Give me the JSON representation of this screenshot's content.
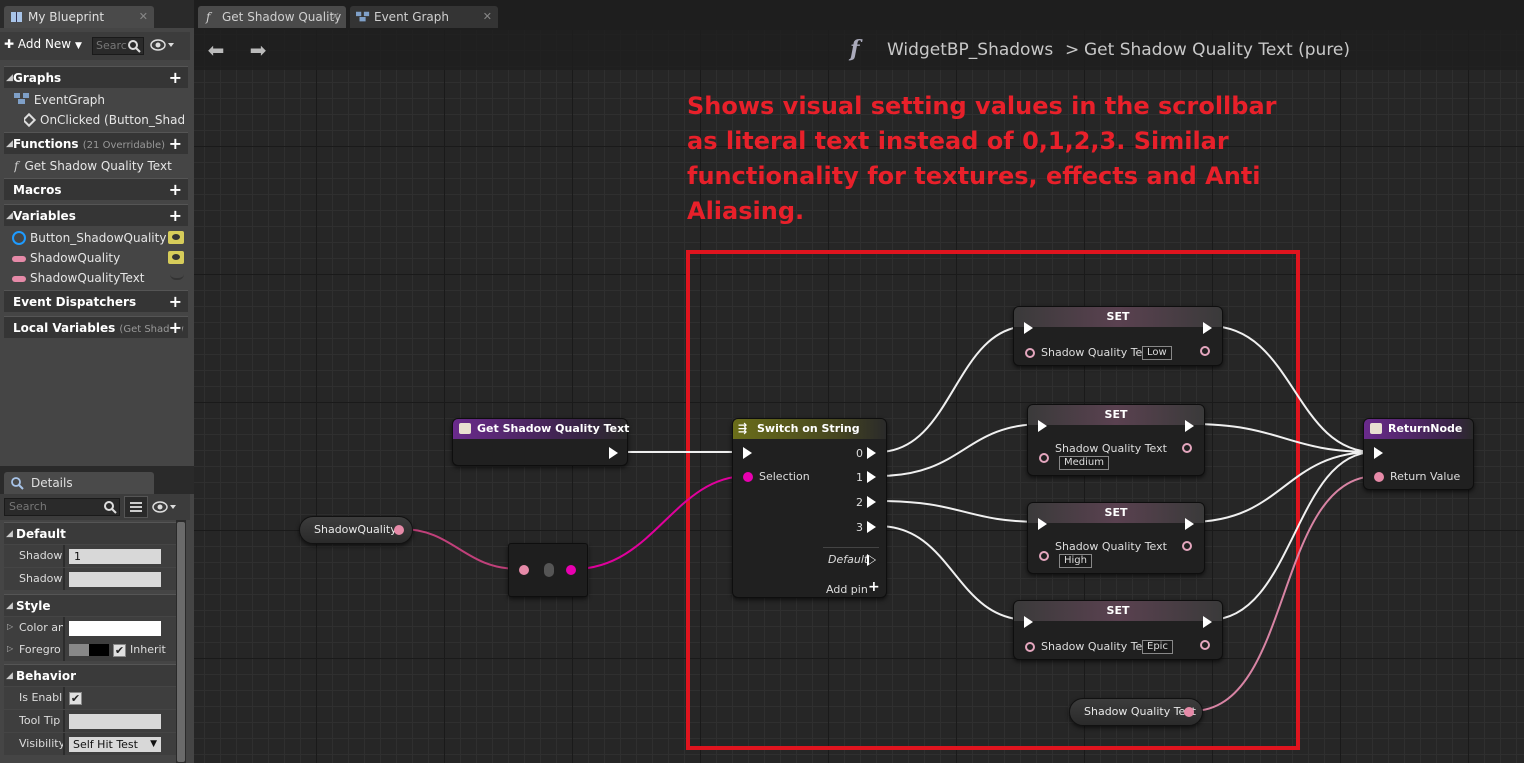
{
  "left_panel": {
    "tab_title": "My Blueprint",
    "add_new_label": "Add New",
    "search_placeholder": "Searc",
    "sections": {
      "graphs": "Graphs",
      "functions": "Functions",
      "functions_sub": "(21 Overridable)",
      "macros": "Macros",
      "variables": "Variables",
      "event_dispatchers": "Event Dispatchers",
      "local_variables": "Local Variables",
      "local_variables_sub": "(Get Shadow"
    },
    "graph_items": [
      "EventGraph",
      "OnClicked (Button_Shad"
    ],
    "function_items": [
      "Get Shadow Quality Text"
    ],
    "variable_items": [
      "Button_ShadowQuality",
      "ShadowQuality",
      "ShadowQualityText"
    ]
  },
  "details": {
    "tab_title": "Details",
    "search_placeholder": "Search",
    "sections": {
      "default": "Default",
      "style": "Style",
      "behavior": "Behavior"
    },
    "default_rows": [
      {
        "label": "Shadow",
        "value": "1"
      },
      {
        "label": "Shadow",
        "value": ""
      }
    ],
    "style_rows": [
      {
        "label": "Color an"
      },
      {
        "label": "Foregro",
        "inherit_label": "Inherit"
      }
    ],
    "behavior_rows": [
      {
        "label": "Is Enabl"
      },
      {
        "label": "Tool Tip",
        "value": ""
      },
      {
        "label": "Visibility",
        "value": "Self Hit Test"
      }
    ]
  },
  "graph_tabs": [
    "Get Shadow Quality",
    "Event Graph"
  ],
  "breadcrumb": {
    "root": "WidgetBP_Shadows",
    "separator": ">",
    "current": "Get Shadow Quality Text (pure)"
  },
  "comment": "Shows visual setting values in the scrollbar as literal text instead of 0,1,2,3. Similar functionality for textures, effects and Anti Aliasing.",
  "nodes": {
    "entry": {
      "title": "Get Shadow Quality Text"
    },
    "get_var": {
      "label": "ShadowQuality"
    },
    "switch": {
      "title": "Switch on String",
      "selection": "Selection",
      "outputs": [
        "0",
        "1",
        "2",
        "3"
      ],
      "default_label": "Default",
      "add_pin": "Add pin"
    },
    "sets": [
      {
        "title": "SET",
        "pin": "Shadow Quality Text",
        "value": "Low"
      },
      {
        "title": "SET",
        "pin": "Shadow Quality Text",
        "value": "Medium"
      },
      {
        "title": "SET",
        "pin": "Shadow Quality Text",
        "value": "High"
      },
      {
        "title": "SET",
        "pin": "Shadow Quality Text",
        "value": "Epic"
      }
    ],
    "get_text": {
      "label": "Shadow Quality Text"
    },
    "return": {
      "title": "ReturnNode",
      "pin": "Return Value"
    }
  },
  "colors": {
    "function_header": "#6a2a8c",
    "switch_header": "#6b6e1a",
    "set_header": "#5a4150",
    "string_pin": "#e8009c",
    "text_pin": "#e68aa8",
    "comment_red": "#e0141e"
  }
}
